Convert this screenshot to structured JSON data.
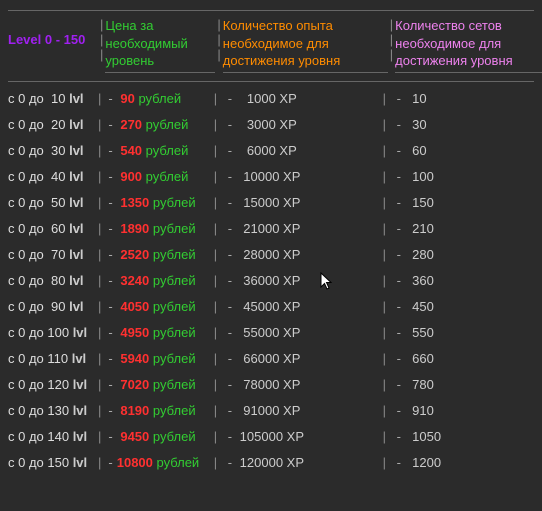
{
  "header": {
    "levelRange": "Level 0 - 150",
    "priceLabel_l1": "Цена за",
    "priceLabel_l2": "необходимый",
    "priceLabel_l3": "уровень",
    "xpLabel_l1": "Количество опыта",
    "xpLabel_l2": "необходимое для",
    "xpLabel_l3": "достижения уровня",
    "setsLabel_l1": "Количество сетов",
    "setsLabel_l2": "необходимое для",
    "setsLabel_l3": "достижения уровня"
  },
  "rowPrefix": "с 0 до",
  "lvlWord": "lvl",
  "priceWord": "рублей",
  "xpSuffix": "XP",
  "chart_data": {
    "type": "table",
    "columns": [
      "level_to",
      "price_rub",
      "xp",
      "sets"
    ],
    "rows": [
      {
        "level_to": 10,
        "price_rub": 90,
        "xp": 1000,
        "sets": 10
      },
      {
        "level_to": 20,
        "price_rub": 270,
        "xp": 3000,
        "sets": 30
      },
      {
        "level_to": 30,
        "price_rub": 540,
        "xp": 6000,
        "sets": 60
      },
      {
        "level_to": 40,
        "price_rub": 900,
        "xp": 10000,
        "sets": 100
      },
      {
        "level_to": 50,
        "price_rub": 1350,
        "xp": 15000,
        "sets": 150
      },
      {
        "level_to": 60,
        "price_rub": 1890,
        "xp": 21000,
        "sets": 210
      },
      {
        "level_to": 70,
        "price_rub": 2520,
        "xp": 28000,
        "sets": 280
      },
      {
        "level_to": 80,
        "price_rub": 3240,
        "xp": 36000,
        "sets": 360
      },
      {
        "level_to": 90,
        "price_rub": 4050,
        "xp": 45000,
        "sets": 450
      },
      {
        "level_to": 100,
        "price_rub": 4950,
        "xp": 55000,
        "sets": 550
      },
      {
        "level_to": 110,
        "price_rub": 5940,
        "xp": 66000,
        "sets": 660
      },
      {
        "level_to": 120,
        "price_rub": 7020,
        "xp": 78000,
        "sets": 780
      },
      {
        "level_to": 130,
        "price_rub": 8190,
        "xp": 91000,
        "sets": 910
      },
      {
        "level_to": 140,
        "price_rub": 9450,
        "xp": 105000,
        "sets": 1050
      },
      {
        "level_to": 150,
        "price_rub": 10800,
        "xp": 120000,
        "sets": 1200
      }
    ]
  }
}
